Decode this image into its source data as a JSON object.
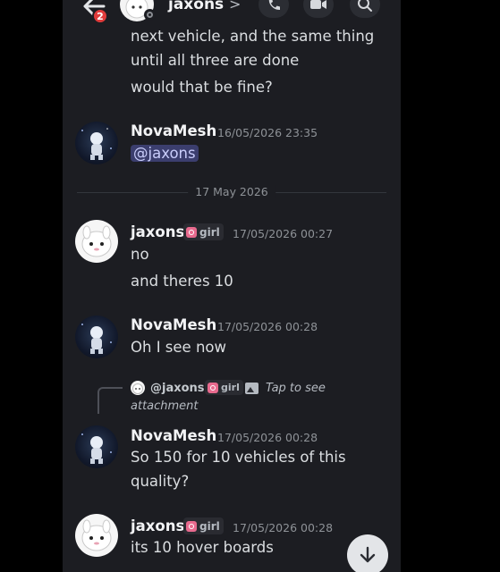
{
  "header": {
    "unread_badge": "2",
    "channel_name": "jaxons",
    "chevron": ">",
    "icons": [
      "back-arrow-icon",
      "phone-icon",
      "video-icon",
      "search-icon"
    ]
  },
  "messages": [
    {
      "lines": [
        "next vehicle, and the same thing",
        "until all three are done",
        "would that be fine?"
      ]
    },
    {
      "author": "NovaMesh",
      "timestamp": "16/05/2026 23:35",
      "mention": "@jaxons"
    },
    {
      "author": "jaxons",
      "tag": "girl",
      "timestamp": "17/05/2026 00:27",
      "lines": [
        "no",
        "and theres 10"
      ]
    },
    {
      "author": "NovaMesh",
      "timestamp": "17/05/2026 00:28",
      "lines": [
        "Oh I see now"
      ]
    },
    {
      "author": "NovaMesh",
      "timestamp": "17/05/2026 00:28",
      "reply": {
        "author": "@jaxons",
        "tag": "girl",
        "attachment_text_1": "Tap to see",
        "attachment_text_2": "attachment"
      },
      "lines": [
        "So 150 for 10 vehicles of this",
        "quality?"
      ]
    },
    {
      "author": "jaxons",
      "tag": "girl",
      "timestamp": "17/05/2026 00:28",
      "lines": [
        "its 10 hover boards"
      ]
    }
  ],
  "date_divider": "17 May 2026",
  "colors": {
    "background": "#1c1d22",
    "mention_bg": "#3b3e6e",
    "badge": "#e03b3b",
    "tag_icon": "#e86a8e"
  }
}
